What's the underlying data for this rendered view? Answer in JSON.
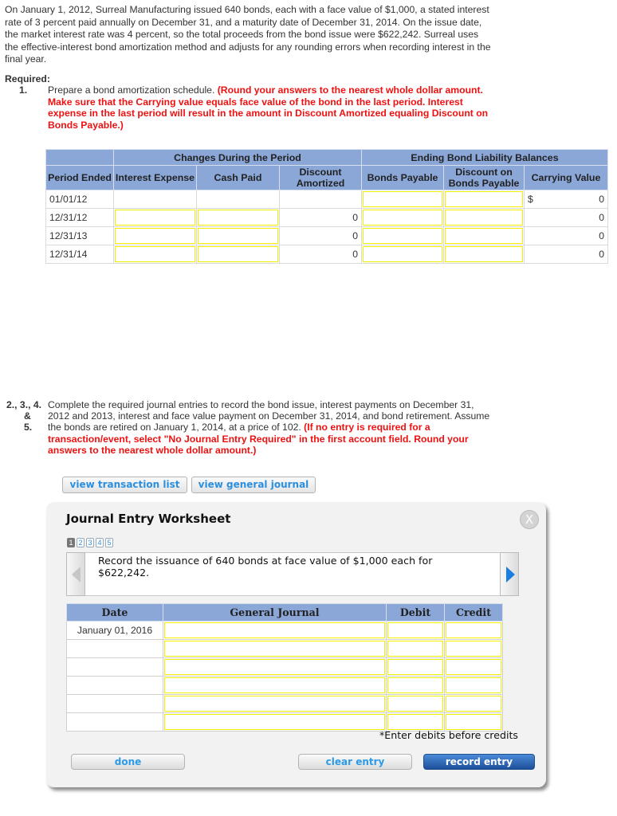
{
  "intro": "On January 1, 2012, Surreal Manufacturing issued 640 bonds, each with a face value of $1,000, a stated interest rate of 3 percent paid annually on December 31, and a maturity date of December 31, 2014. On the issue date, the market interest rate was 4 percent, so the total proceeds from the bond issue were $622,242. Surreal uses the effective-interest bond amortization method and adjusts for any rounding errors when recording interest in the final year.",
  "required_label": "Required:",
  "req1": {
    "number": "1.",
    "text": "Prepare a bond amortization schedule.",
    "instruction": "(Round your answers to the nearest whole dollar amount. Make sure that the Carrying value equals face value of the bond in the last period. Interest expense in the last period will result in the amount in Discount Amortized equaling Discount on Bonds Payable.)"
  },
  "amort_table": {
    "group_headers": [
      "Changes During the Period",
      "Ending Bond Liability Balances"
    ],
    "columns": [
      "Period Ended",
      "Interest Expense",
      "Cash Paid",
      "Discount Amortized",
      "Bonds Payable",
      "Discount on Bonds Payable",
      "Carrying Value"
    ],
    "currency_symbol": "$",
    "rows": [
      {
        "period": "01/01/12",
        "interest_expense": "",
        "cash_paid": "",
        "discount_amortized": "",
        "bonds_payable": "",
        "discount_on_bp": "",
        "carrying_value": "0"
      },
      {
        "period": "12/31/12",
        "interest_expense": "",
        "cash_paid": "",
        "discount_amortized": "0",
        "bonds_payable": "",
        "discount_on_bp": "",
        "carrying_value": "0"
      },
      {
        "period": "12/31/13",
        "interest_expense": "",
        "cash_paid": "",
        "discount_amortized": "0",
        "bonds_payable": "",
        "discount_on_bp": "",
        "carrying_value": "0"
      },
      {
        "period": "12/31/14",
        "interest_expense": "",
        "cash_paid": "",
        "discount_amortized": "0",
        "bonds_payable": "",
        "discount_on_bp": "",
        "carrying_value": "0"
      }
    ]
  },
  "req2": {
    "labels": [
      "2., 3., 4.",
      "&",
      "5."
    ],
    "text": "Complete the required journal entries to record the bond issue, interest payments on December 31, 2012 and 2013, interest and face value payment on December 31, 2014, and bond retirement. Assume the bonds are retired on January 1, 2014, at a price of 102.",
    "instruction": "(If no entry is required for a transaction/event, select \"No Journal Entry Required\" in the first account field. Round your answers to the nearest whole dollar amount.)"
  },
  "buttons": {
    "view_transaction_list": "view transaction list",
    "view_general_journal": "view general journal",
    "done": "done",
    "clear_entry": "clear entry",
    "record_entry": "record entry"
  },
  "worksheet": {
    "title": "Journal Entry Worksheet",
    "close_glyph": "X",
    "pages": [
      "1",
      "2",
      "3",
      "4",
      "5"
    ],
    "current_page": "1",
    "description": "Record the issuance of 640 bonds at face value of $1,000 each for $622,242.",
    "columns": [
      "Date",
      "General Journal",
      "Debit",
      "Credit"
    ],
    "rows": [
      {
        "date": "January 01, 2016",
        "account": "",
        "debit": "",
        "credit": ""
      },
      {
        "date": "",
        "account": "",
        "debit": "",
        "credit": ""
      },
      {
        "date": "",
        "account": "",
        "debit": "",
        "credit": ""
      },
      {
        "date": "",
        "account": "",
        "debit": "",
        "credit": ""
      },
      {
        "date": "",
        "account": "",
        "debit": "",
        "credit": ""
      },
      {
        "date": "",
        "account": "",
        "debit": "",
        "credit": ""
      }
    ],
    "note": "*Enter debits before credits"
  },
  "colors": {
    "header_blue": "#8aa7d8",
    "instruction_red": "#ee1111",
    "input_border_yellow": "#f2f000",
    "link_blue": "#2b8fe0",
    "primary_button": "#1d4f9a"
  }
}
